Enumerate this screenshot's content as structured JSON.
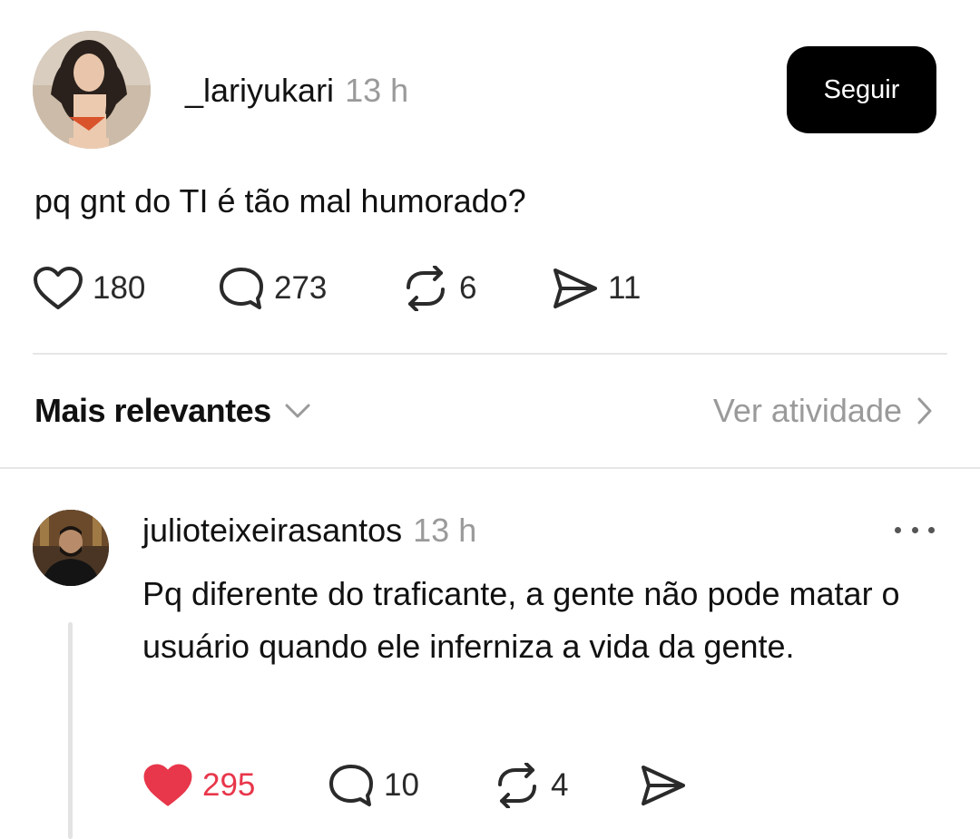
{
  "post": {
    "author": "_lariyukari",
    "time": "13 h",
    "follow_label": "Seguir",
    "text": "pq gnt do TI é tão mal humorado?",
    "likes": "180",
    "comments": "273",
    "reposts": "6",
    "shares": "11"
  },
  "sort": {
    "label": "Mais relevantes",
    "activity_label": "Ver atividade"
  },
  "reply": {
    "author": "julioteixeirasantos",
    "time": "13 h",
    "text": "Pq diferente do traficante, a gente não pode matar o usuário quando ele inferniza a vida da gente.",
    "likes": "295",
    "liked": true,
    "comments": "10",
    "reposts": "4"
  },
  "icons": {
    "like": "heart-icon",
    "comment": "speech-bubble-icon",
    "repost": "repost-arrows-icon",
    "share": "paper-plane-icon",
    "more": "ellipsis-icon"
  },
  "colors": {
    "like_active": "#e8364a",
    "muted_text": "#9a9a9a",
    "follow_button_bg": "#000000"
  }
}
